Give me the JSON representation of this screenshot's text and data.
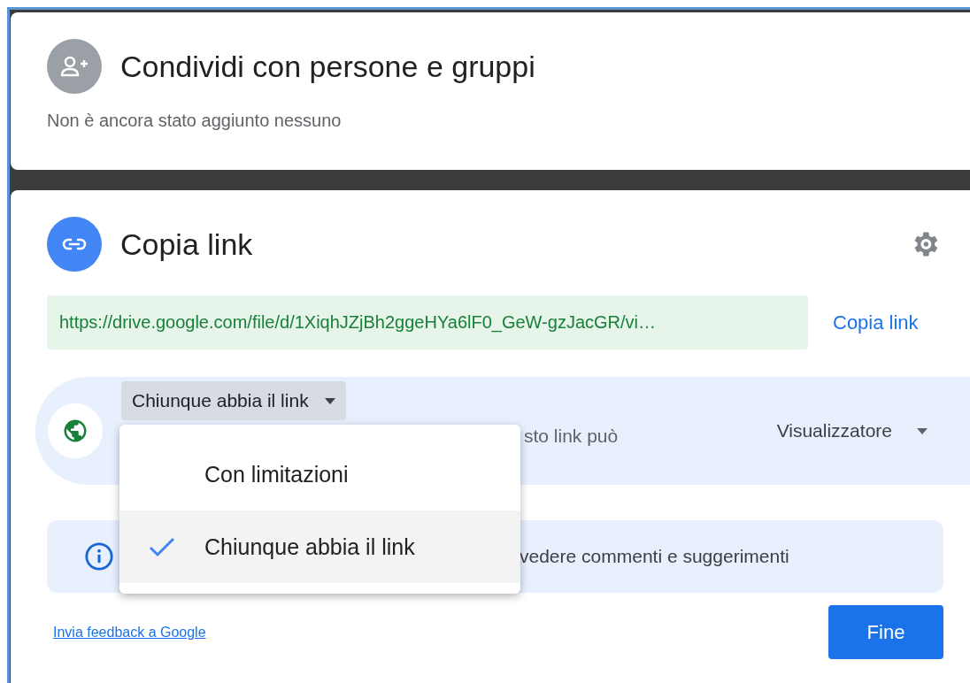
{
  "share_card": {
    "title": "Condividi con persone e gruppi",
    "subtitle": "Non è ancora stato aggiunto nessuno"
  },
  "link_card": {
    "title": "Copia link",
    "url": "https://drive.google.com/file/d/1XiqhJZjBh2ggeHYa6lF0_GeW-gzJacGR/vi…",
    "copy_button": "Copia link",
    "access": {
      "dropdown": {
        "label": "Chiunque abbia il link",
        "expanded": true
      },
      "description_fragment": "sto link può",
      "role": "Visualizzatore"
    },
    "info_fragment": "vedere commenti e suggerimenti",
    "menu": [
      {
        "label": "Con limitazioni",
        "selected": false
      },
      {
        "label": "Chiunque abbia il link",
        "selected": true
      }
    ],
    "feedback_link": "Invia feedback a Google",
    "done_button": "Fine"
  }
}
